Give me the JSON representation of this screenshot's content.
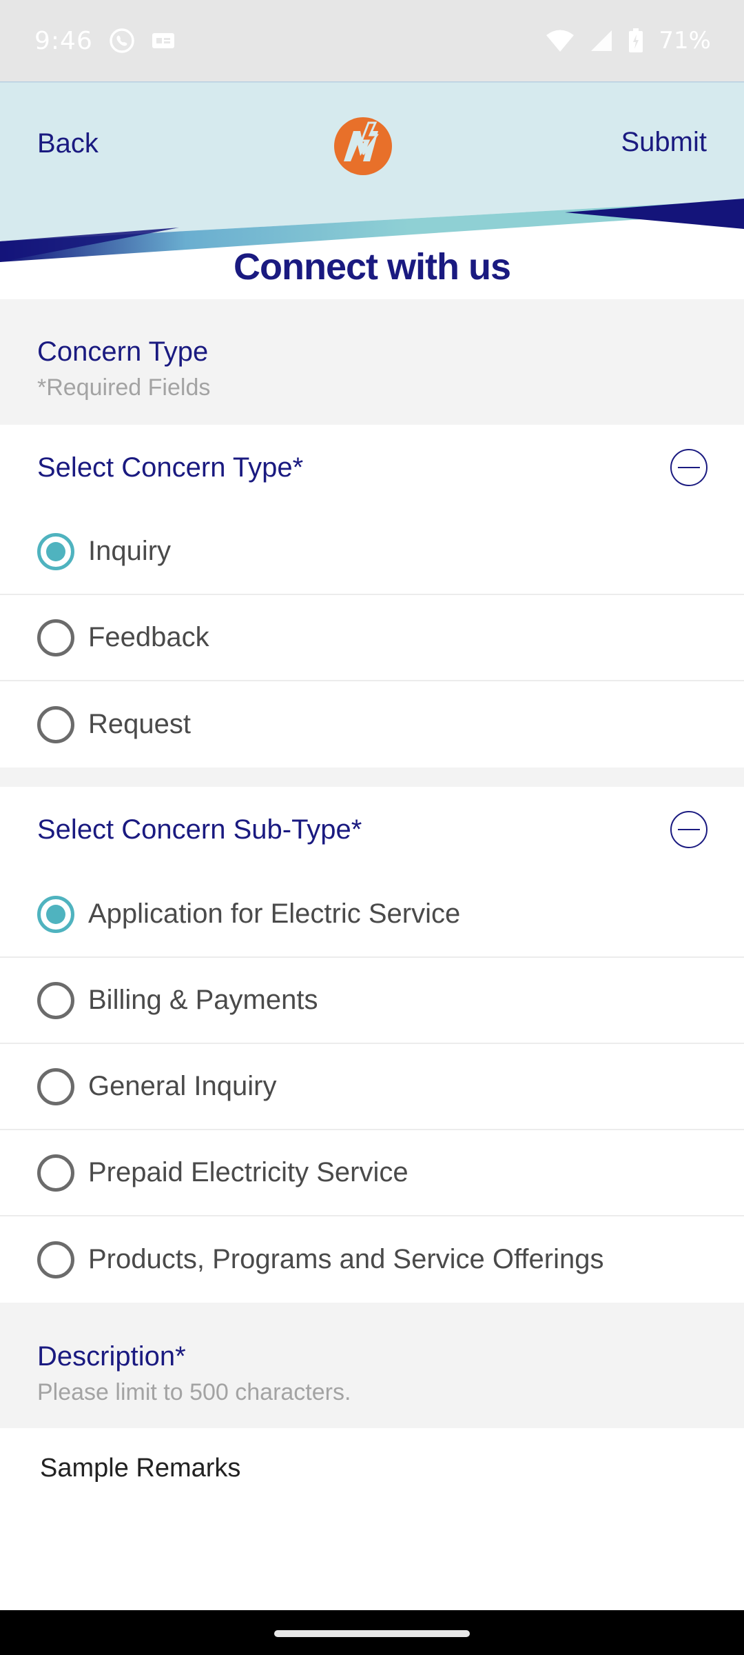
{
  "status_bar": {
    "time": "9:46",
    "battery_text": "71%",
    "icons": [
      "viber-icon",
      "card-icon",
      "wifi-icon",
      "signal-icon",
      "battery-icon"
    ]
  },
  "header": {
    "back_label": "Back",
    "submit_label": "Submit",
    "title": "Connect with us",
    "colors": {
      "header_bg": "#d6eaee",
      "navy": "#14147a",
      "teal": "#7fc6cc",
      "logo_orange": "#e8702a"
    }
  },
  "concern_type_section": {
    "title": "Concern Type",
    "subtitle": "*Required Fields"
  },
  "concern_type_group": {
    "title": "Select Concern Type*",
    "options": [
      {
        "label": "Inquiry",
        "selected": true
      },
      {
        "label": "Feedback",
        "selected": false
      },
      {
        "label": "Request",
        "selected": false
      }
    ]
  },
  "concern_subtype_group": {
    "title": "Select Concern Sub-Type*",
    "options": [
      {
        "label": "Application for Electric Service",
        "selected": true
      },
      {
        "label": "Billing & Payments",
        "selected": false
      },
      {
        "label": "General Inquiry",
        "selected": false
      },
      {
        "label": "Prepaid Electricity Service",
        "selected": false
      },
      {
        "label": "Products, Programs and Service Offerings",
        "selected": false
      }
    ]
  },
  "description_section": {
    "title": "Description*",
    "subtitle": "Please limit to 500 characters.",
    "value": "Sample Remarks"
  }
}
